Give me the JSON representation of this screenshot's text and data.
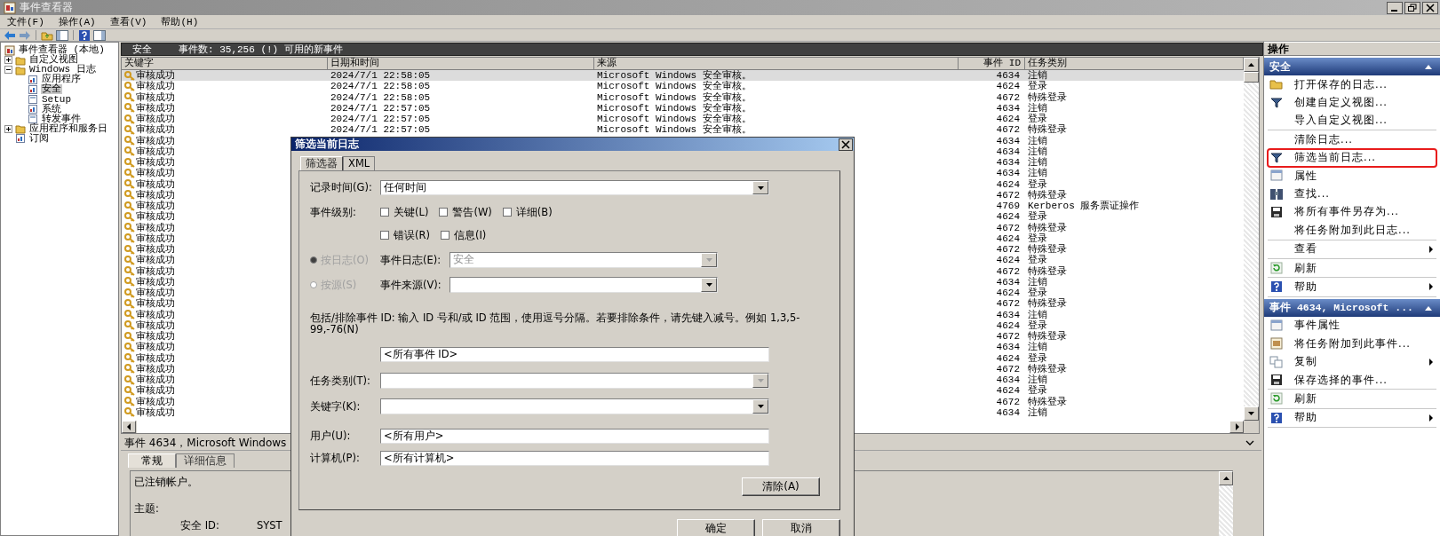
{
  "window": {
    "title": "事件查看器"
  },
  "menu": [
    "文件(F)",
    "操作(A)",
    "查看(V)",
    "帮助(H)"
  ],
  "tree": [
    {
      "label": "事件查看器 (本地)",
      "kind": "root",
      "selected": false,
      "children": [
        {
          "label": "自定义视图",
          "kind": "folder",
          "selected": false,
          "expanded": false
        },
        {
          "label": "Windows 日志",
          "kind": "folder",
          "selected": false,
          "expanded": true,
          "children": [
            {
              "label": "应用程序",
              "kind": "log",
              "selected": false
            },
            {
              "label": "安全",
              "kind": "log",
              "selected": true
            },
            {
              "label": "Setup",
              "kind": "page",
              "selected": false
            },
            {
              "label": "系统",
              "kind": "log",
              "selected": false
            },
            {
              "label": "转发事件",
              "kind": "page",
              "selected": false
            }
          ]
        },
        {
          "label": "应用程序和服务日",
          "kind": "folder",
          "selected": false,
          "expanded": false
        },
        {
          "label": "订阅",
          "kind": "log",
          "selected": false
        }
      ]
    }
  ],
  "log_header": {
    "log": "安全",
    "count": "事件数: 35,256 (!) 可用的新事件"
  },
  "table": {
    "columns": [
      "关键字",
      "日期和时间",
      "来源",
      "事件 ID",
      "任务类别"
    ],
    "rows": [
      {
        "keyword": "审核成功",
        "date": "2024/7/1 22:58:05",
        "source": "Microsoft Windows 安全审核。",
        "event_id": "4634",
        "task": "注销",
        "selected": true
      },
      {
        "keyword": "审核成功",
        "date": "2024/7/1 22:58:05",
        "source": "Microsoft Windows 安全审核。",
        "event_id": "4624",
        "task": "登录",
        "selected": false
      },
      {
        "keyword": "审核成功",
        "date": "2024/7/1 22:58:05",
        "source": "Microsoft Windows 安全审核。",
        "event_id": "4672",
        "task": "特殊登录",
        "selected": false
      },
      {
        "keyword": "审核成功",
        "date": "2024/7/1 22:57:05",
        "source": "Microsoft Windows 安全审核。",
        "event_id": "4634",
        "task": "注销",
        "selected": false
      },
      {
        "keyword": "审核成功",
        "date": "2024/7/1 22:57:05",
        "source": "Microsoft Windows 安全审核。",
        "event_id": "4624",
        "task": "登录",
        "selected": false
      },
      {
        "keyword": "审核成功",
        "date": "2024/7/1 22:57:05",
        "source": "Microsoft Windows 安全审核。",
        "event_id": "4672",
        "task": "特殊登录",
        "selected": false
      },
      {
        "keyword": "审核成功",
        "event_id": "4634",
        "task": "注销",
        "selected": false
      },
      {
        "keyword": "审核成功",
        "event_id": "4634",
        "task": "注销",
        "selected": false
      },
      {
        "keyword": "审核成功",
        "event_id": "4634",
        "task": "注销",
        "selected": false
      },
      {
        "keyword": "审核成功",
        "event_id": "4634",
        "task": "注销",
        "selected": false
      },
      {
        "keyword": "审核成功",
        "event_id": "4624",
        "task": "登录",
        "selected": false
      },
      {
        "keyword": "审核成功",
        "event_id": "4672",
        "task": "特殊登录",
        "selected": false
      },
      {
        "keyword": "审核成功",
        "event_id": "4769",
        "task": "Kerberos 服务票证操作",
        "selected": false
      },
      {
        "keyword": "审核成功",
        "event_id": "4624",
        "task": "登录",
        "selected": false
      },
      {
        "keyword": "审核成功",
        "event_id": "4672",
        "task": "特殊登录",
        "selected": false
      },
      {
        "keyword": "审核成功",
        "event_id": "4624",
        "task": "登录",
        "selected": false
      },
      {
        "keyword": "审核成功",
        "event_id": "4672",
        "task": "特殊登录",
        "selected": false
      },
      {
        "keyword": "审核成功",
        "event_id": "4624",
        "task": "登录",
        "selected": false
      },
      {
        "keyword": "审核成功",
        "event_id": "4672",
        "task": "特殊登录",
        "selected": false
      },
      {
        "keyword": "审核成功",
        "event_id": "4634",
        "task": "注销",
        "selected": false
      },
      {
        "keyword": "审核成功",
        "event_id": "4624",
        "task": "登录",
        "selected": false
      },
      {
        "keyword": "审核成功",
        "event_id": "4672",
        "task": "特殊登录",
        "selected": false
      },
      {
        "keyword": "审核成功",
        "event_id": "4634",
        "task": "注销",
        "selected": false
      },
      {
        "keyword": "审核成功",
        "event_id": "4624",
        "task": "登录",
        "selected": false
      },
      {
        "keyword": "审核成功",
        "event_id": "4672",
        "task": "特殊登录",
        "selected": false
      },
      {
        "keyword": "审核成功",
        "event_id": "4634",
        "task": "注销",
        "selected": false
      },
      {
        "keyword": "审核成功",
        "event_id": "4624",
        "task": "登录",
        "selected": false
      },
      {
        "keyword": "审核成功",
        "event_id": "4672",
        "task": "特殊登录",
        "selected": false
      },
      {
        "keyword": "审核成功",
        "event_id": "4634",
        "task": "注销",
        "selected": false
      },
      {
        "keyword": "审核成功",
        "event_id": "4624",
        "task": "登录",
        "selected": false
      },
      {
        "keyword": "审核成功",
        "event_id": "4672",
        "task": "特殊登录",
        "selected": false
      },
      {
        "keyword": "审核成功",
        "event_id": "4634",
        "task": "注销",
        "selected": false
      }
    ]
  },
  "details": {
    "title": "事件 4634，Microsoft Windows",
    "tabs": [
      {
        "label": "常规",
        "selected": true
      },
      {
        "label": "详细信息",
        "selected": false
      }
    ],
    "message": "已注销帐户。",
    "section": "主题:",
    "field": {
      "label": "安全 ID:",
      "value": "SYST"
    }
  },
  "actions": {
    "title": "操作",
    "sections": [
      {
        "title": "安全",
        "groups": [
          [
            {
              "label": "打开保存的日志...",
              "kind": "folder",
              "submenu": false,
              "highlighted": false
            },
            {
              "label": "创建自定义视图...",
              "kind": "filter",
              "submenu": false,
              "highlighted": false
            },
            {
              "label": "导入自定义视图...",
              "kind": "plain",
              "submenu": false,
              "highlighted": false
            }
          ],
          [
            {
              "label": "清除日志...",
              "kind": "plain",
              "submenu": false,
              "highlighted": false
            },
            {
              "label": "筛选当前日志...",
              "kind": "filter",
              "submenu": false,
              "highlighted": true
            },
            {
              "label": "属性",
              "kind": "properties",
              "submenu": false,
              "highlighted": false
            },
            {
              "label": "查找...",
              "kind": "find",
              "submenu": false,
              "highlighted": false
            },
            {
              "label": "将所有事件另存为...",
              "kind": "save",
              "submenu": false,
              "highlighted": false
            },
            {
              "label": "将任务附加到此日志...",
              "kind": "plain",
              "submenu": false,
              "highlighted": false
            }
          ],
          [
            {
              "label": "查看",
              "kind": "plain",
              "submenu": true,
              "highlighted": false
            }
          ],
          [
            {
              "label": "刷新",
              "kind": "refresh",
              "submenu": false,
              "highlighted": false
            }
          ],
          [
            {
              "label": "帮助",
              "kind": "help",
              "submenu": true,
              "highlighted": false
            }
          ]
        ]
      },
      {
        "title": "事件 4634, Microsoft ...",
        "groups": [
          [
            {
              "label": "事件属性",
              "kind": "properties",
              "submenu": false,
              "highlighted": false
            },
            {
              "label": "将任务附加到此事件...",
              "kind": "task",
              "submenu": false,
              "highlighted": false
            },
            {
              "label": "复制",
              "kind": "copy",
              "submenu": true,
              "highlighted": false
            },
            {
              "label": "保存选择的事件...",
              "kind": "save",
              "submenu": false,
              "highlighted": false
            }
          ],
          [
            {
              "label": "刷新",
              "kind": "refresh",
              "submenu": false,
              "highlighted": false
            }
          ],
          [
            {
              "label": "帮助",
              "kind": "help",
              "submenu": true,
              "highlighted": false
            }
          ]
        ]
      }
    ]
  },
  "dialog": {
    "title": "筛选当前日志",
    "tabs": [
      {
        "label": "筛选器",
        "selected": true
      },
      {
        "label": "XML",
        "selected": false
      }
    ],
    "logged": {
      "label": "记录时间(G):",
      "value": "任何时间"
    },
    "level": {
      "label": "事件级别:",
      "rows": [
        [
          {
            "label": "关键(L)",
            "checked": false
          },
          {
            "label": "警告(W)",
            "checked": false
          },
          {
            "label": "详细(B)",
            "checked": false
          }
        ],
        [
          {
            "label": "错误(R)",
            "checked": false
          },
          {
            "label": "信息(I)",
            "checked": false
          }
        ]
      ]
    },
    "scope": [
      {
        "label": "按日志(O)",
        "selected": true,
        "disabled": true,
        "field_label": "事件日志(E):",
        "value": "安全",
        "field_disabled": true
      },
      {
        "label": "按源(S)",
        "selected": false,
        "disabled": true,
        "field_label": "事件来源(V):",
        "field_disabled": false
      }
    ],
    "id_hint": "包括/排除事件 ID: 输入 ID 号和/或 ID 范围，使用逗号分隔。若要排除条件，请先键入减号。例如 1,3,5-99,-76(N)",
    "event_ids": "<所有事件 ID>",
    "task_category": {
      "label": "任务类别(T):",
      "disabled": true
    },
    "keywords": {
      "label": "关键字(K):",
      "disabled": false
    },
    "user": {
      "label": "用户(U):",
      "value": "<所有用户>"
    },
    "computer": {
      "label": "计算机(P):",
      "value": "<所有计算机>"
    },
    "clear_button": "清除(A)",
    "buttons": [
      "确定",
      "取消"
    ]
  }
}
